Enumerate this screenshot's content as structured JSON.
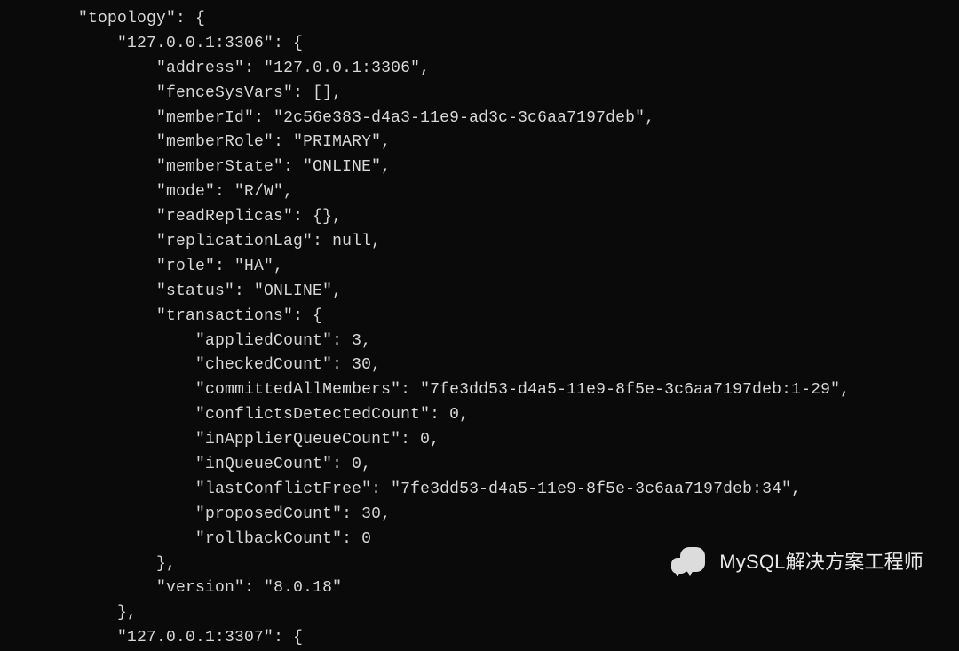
{
  "indent": {
    "i2": "        ",
    "i3": "            ",
    "i4": "                ",
    "i5": "                    "
  },
  "code": {
    "l01_key": "\"topology\"",
    "l01_rest": ": {",
    "l02_key": "\"127.0.0.1:3306\"",
    "l02_rest": ": {",
    "l03_key": "\"address\"",
    "l03_rest": ": \"127.0.0.1:3306\",",
    "l04_key": "\"fenceSysVars\"",
    "l04_rest": ": [],",
    "l05_key": "\"memberId\"",
    "l05_rest": ": \"2c56e383-d4a3-11e9-ad3c-3c6aa7197deb\",",
    "l06_key": "\"memberRole\"",
    "l06_rest": ": \"PRIMARY\",",
    "l07_key": "\"memberState\"",
    "l07_rest": ": \"ONLINE\",",
    "l08_key": "\"mode\"",
    "l08_rest": ": \"R/W\",",
    "l09_key": "\"readReplicas\"",
    "l09_rest": ": {},",
    "l10_key": "\"replicationLag\"",
    "l10_rest": ": null,",
    "l11_key": "\"role\"",
    "l11_rest": ": \"HA\",",
    "l12_key": "\"status\"",
    "l12_rest": ": \"ONLINE\",",
    "l13_key": "\"transactions\"",
    "l13_rest": ": {",
    "l14_key": "\"appliedCount\"",
    "l14_rest": ": 3,",
    "l15_key": "\"checkedCount\"",
    "l15_rest": ": 30,",
    "l16_key": "\"committedAllMembers\"",
    "l16_rest": ": \"7fe3dd53-d4a5-11e9-8f5e-3c6aa7197deb:1-29\",",
    "l17_key": "\"conflictsDetectedCount\"",
    "l17_rest": ": 0,",
    "l18_key": "\"inApplierQueueCount\"",
    "l18_rest": ": 0,",
    "l19_key": "\"inQueueCount\"",
    "l19_rest": ": 0,",
    "l20_key": "\"lastConflictFree\"",
    "l20_rest": ": \"7fe3dd53-d4a5-11e9-8f5e-3c6aa7197deb:34\",",
    "l21_key": "\"proposedCount\"",
    "l21_rest": ": 30,",
    "l22_key": "\"rollbackCount\"",
    "l22_rest": ": 0",
    "l23": "},",
    "l24_key": "\"version\"",
    "l24_rest": ": \"8.0.18\"",
    "l25": "},",
    "l26_key": "\"127.0.0.1:3307\"",
    "l26_rest": ": {"
  },
  "watermark": {
    "text": "MySQL解决方案工程师"
  }
}
